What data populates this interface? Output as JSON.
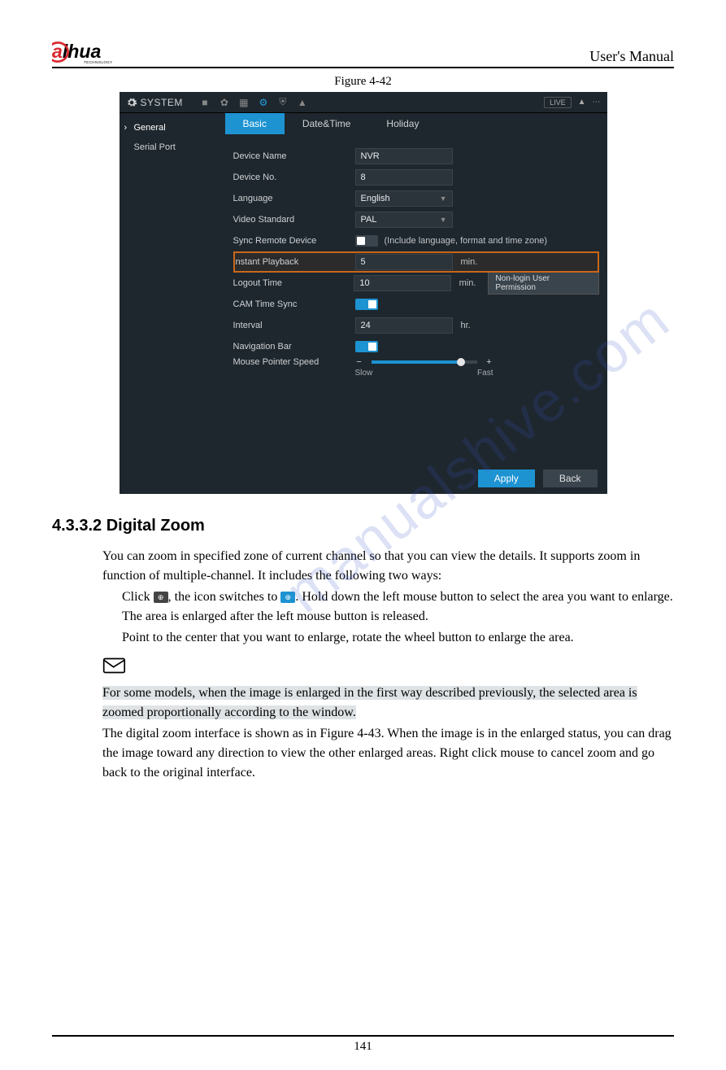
{
  "header": {
    "brand": "alhua",
    "brand_sub": "TECHNOLOGY",
    "right": "User's Manual"
  },
  "figure_label": "Figure 4-42",
  "watermark": "manualshive.com",
  "system": {
    "title": "SYSTEM",
    "live_badge": "LIVE",
    "sidebar": [
      {
        "label": "General",
        "active": true
      },
      {
        "label": "Serial Port",
        "active": false
      }
    ],
    "tabs": [
      {
        "label": "Basic",
        "active": true
      },
      {
        "label": "Date&Time",
        "active": false
      },
      {
        "label": "Holiday",
        "active": false
      }
    ],
    "fields": {
      "device_name": {
        "label": "Device Name",
        "value": "NVR"
      },
      "device_no": {
        "label": "Device No.",
        "value": "8"
      },
      "language": {
        "label": "Language",
        "value": "English"
      },
      "video_standard": {
        "label": "Video Standard",
        "value": "PAL"
      },
      "sync_remote": {
        "label": "Sync Remote Device",
        "note": "(Include language, format and time zone)"
      },
      "instant_playback": {
        "label": "Instant Playback",
        "value": "5",
        "unit": "min."
      },
      "logout_time": {
        "label": "Logout Time",
        "value": "10",
        "unit": "min.",
        "button": "Non-login User Permission"
      },
      "cam_time_sync": {
        "label": "CAM Time Sync"
      },
      "interval": {
        "label": "Interval",
        "value": "24",
        "unit": "hr."
      },
      "nav_bar": {
        "label": "Navigation Bar"
      },
      "mouse_speed": {
        "label": "Mouse Pointer Speed",
        "slow": "Slow",
        "fast": "Fast"
      }
    },
    "buttons": {
      "apply": "Apply",
      "back": "Back"
    }
  },
  "section": {
    "heading": "4.3.3.2 Digital Zoom",
    "p1": "You can zoom in specified zone of current channel so that you can view the details. It supports zoom in function of multiple-channel. It includes the following two ways:",
    "b1a": "Click ",
    "b1b": ", the icon switches to ",
    "b1c": ". Hold down the left mouse button to select the area you want to enlarge. The area is enlarged after the left mouse button is released.",
    "b2": "Point to the center that you want to enlarge, rotate the wheel button to enlarge the area.",
    "note": "For some models, when the image is enlarged in the first way described previously, the selected area is zoomed proportionally according to the window.",
    "p2a": "The digital zoom interface is shown as in ",
    "p2b": "Figure 4-43",
    "p2c": ". When the image is in the enlarged status, you can drag the image toward any direction to view the other enlarged areas. Right click mouse to cancel zoom and go back to the original interface."
  },
  "page_number": "141"
}
